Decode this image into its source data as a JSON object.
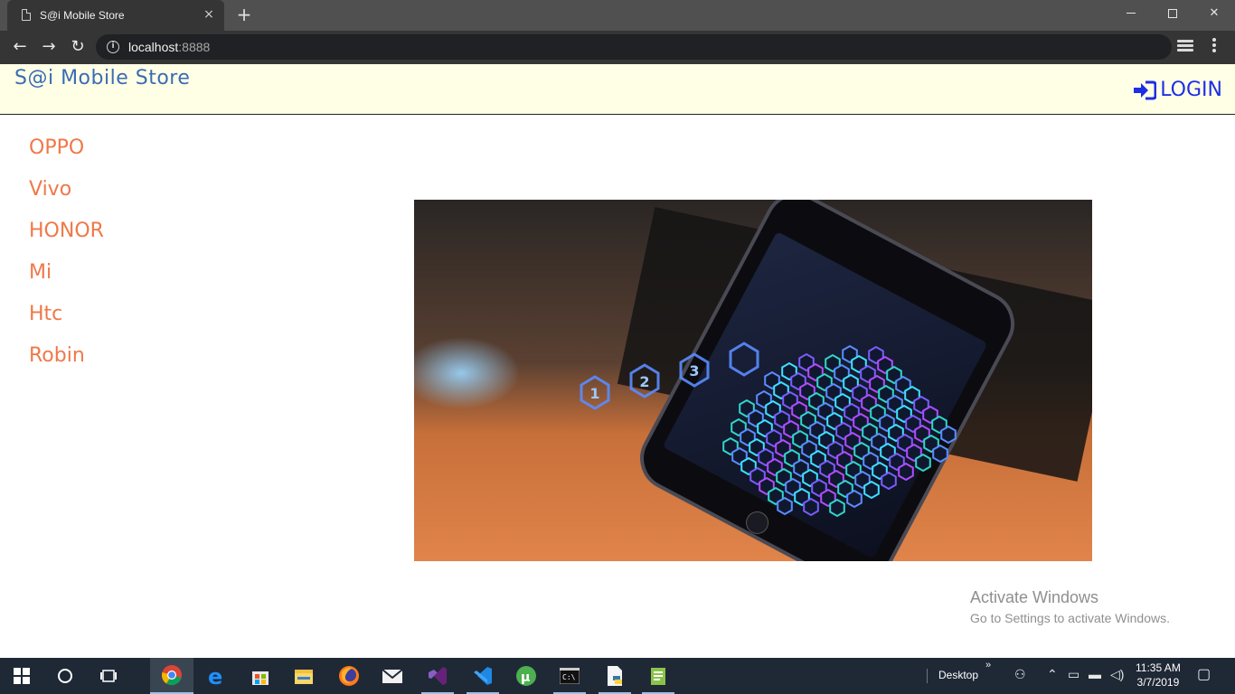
{
  "browser": {
    "tab_title": "S@i Mobile Store",
    "tab_close": "×",
    "new_tab": "+",
    "url_host": "localhost",
    "url_port": ":8888",
    "nav_back": "←",
    "nav_forward": "→",
    "nav_reload": "↻",
    "bookmark": "☆"
  },
  "site": {
    "brand": "S@i Mobile Store",
    "login_label": "LOGIN",
    "login_color": "#1e2ee6",
    "header_bg": "#ffffe6",
    "brand_color": "#3a6cb4",
    "menu_color": "#f07848",
    "phone_brands": [
      "OPPO",
      "Vivo",
      "HONOR",
      "Mi",
      "Htc",
      "Robin"
    ],
    "hero_image": {
      "description": "smartphone on desk showing hexagonal PIN-code keypad",
      "keypad_digits": [
        "1",
        "2",
        "3"
      ]
    }
  },
  "watermark": {
    "title": "Activate Windows",
    "subtitle": "Go to Settings to activate Windows."
  },
  "taskbar": {
    "desktop_label": "Desktop",
    "time": "11:35 AM",
    "date": "3/7/2019",
    "apps": [
      "start",
      "search",
      "task-view",
      "chrome",
      "edge",
      "store",
      "explorer",
      "firefox",
      "mail",
      "visual-studio",
      "vscode",
      "utorrent",
      "cmd",
      "python-file",
      "notepad-file"
    ]
  }
}
